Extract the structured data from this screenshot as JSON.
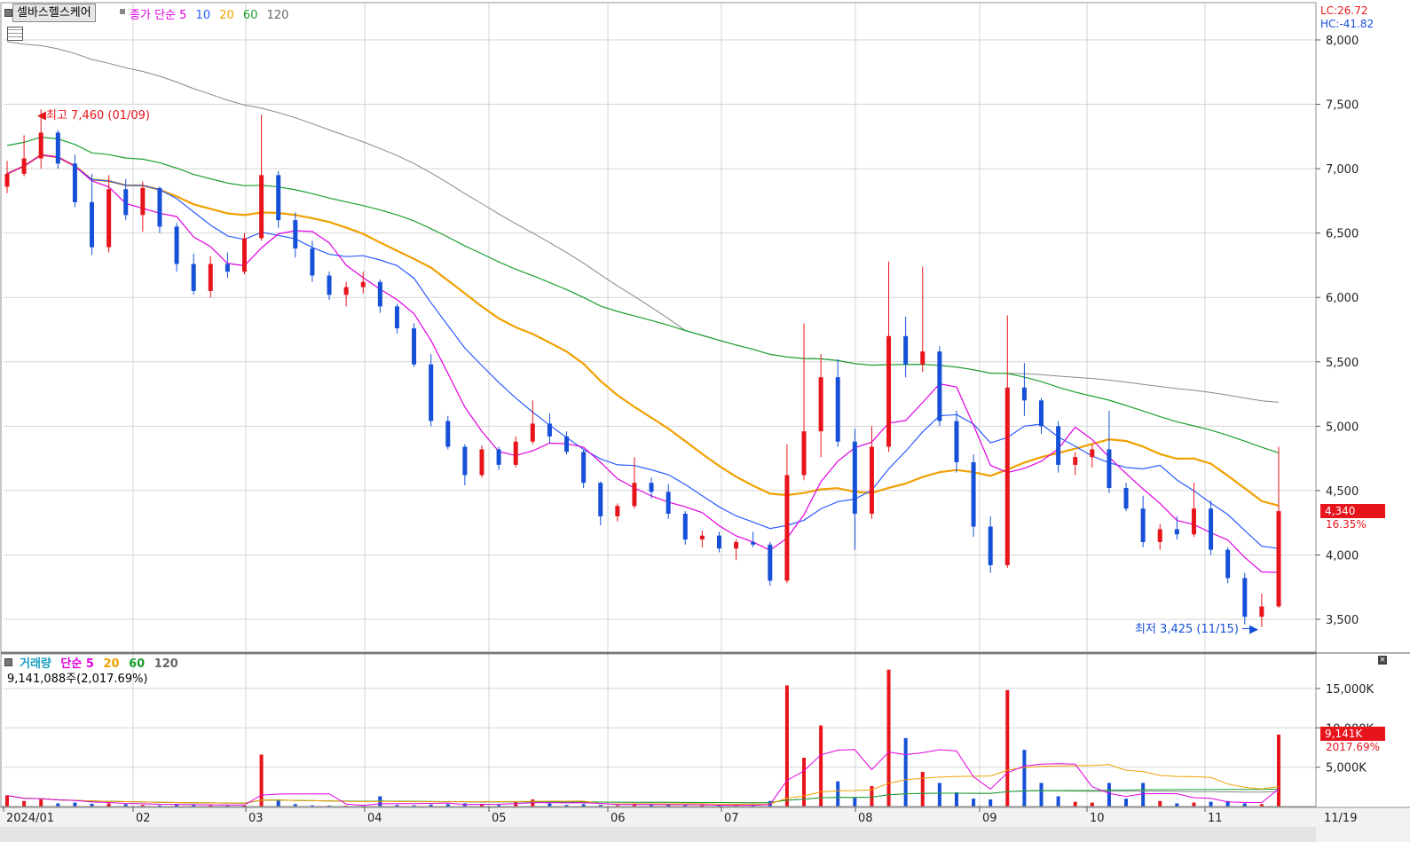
{
  "stock_name": "셀바스헬스케어",
  "price_panel": {
    "label": "종가",
    "ma_label": "단순",
    "ma_periods": [
      "5",
      "10",
      "20",
      "60",
      "120"
    ],
    "ma_colors": {
      "5": "#e000e0",
      "10": "#2a5cff",
      "20": "#f0a000",
      "60": "#1aa030",
      "120": "#888888"
    },
    "lc_text": "LC:26.72",
    "hc_text": "HC:-41.82",
    "high_note": "최고 7,460 (01/09)",
    "low_note": "최저 3,425 (11/15)",
    "current_price": "4,340",
    "current_change": "16.35%",
    "y_ticks": [
      "8,000",
      "7,500",
      "7,000",
      "6,500",
      "6,000",
      "5,500",
      "5,000",
      "4,500",
      "4,000",
      "3,500"
    ]
  },
  "volume_panel": {
    "label": "거래량",
    "ma_label": "단순",
    "ma_periods": [
      "5",
      "20",
      "60",
      "120"
    ],
    "value_text": "9,141,088주(2,017.69%)",
    "current_volume": "9,141K",
    "current_change": "2017.69%",
    "y_ticks": [
      "15,000K",
      "10,000K",
      "5,000K"
    ]
  },
  "x_axis": {
    "labels": [
      "2024/01",
      "02",
      "03",
      "04",
      "05",
      "06",
      "07",
      "08",
      "09",
      "10",
      "11"
    ],
    "end_label": "11/19"
  },
  "colors": {
    "up": "#e8141c",
    "down": "#1650d8",
    "grid": "#d4d4d4",
    "border": "#909090"
  },
  "chart_data": {
    "type": "candlestick",
    "period": "2024/01 – 11/19",
    "ylim": [
      3400,
      8100
    ],
    "volume_ylim": [
      0,
      18000
    ],
    "ma_periods": [
      5,
      10,
      20,
      60,
      120
    ],
    "volume_ma_periods": [
      5,
      20,
      60,
      120
    ],
    "high": {
      "value": 7460,
      "date": "01/09"
    },
    "low": {
      "value": 3425,
      "date": "11/15"
    },
    "last": {
      "close": 4340,
      "change_pct": 16.35,
      "volume_k": 9141,
      "volume_change_pct": 2017.69
    },
    "ohlc": [
      [
        6860,
        7060,
        6810,
        6960
      ],
      [
        6960,
        7260,
        6940,
        7080
      ],
      [
        7080,
        7460,
        7000,
        7280
      ],
      [
        7280,
        7300,
        7000,
        7040
      ],
      [
        7040,
        7110,
        6700,
        6740
      ],
      [
        6740,
        6960,
        6330,
        6390
      ],
      [
        6390,
        6950,
        6350,
        6840
      ],
      [
        6840,
        6920,
        6600,
        6640
      ],
      [
        6640,
        6900,
        6510,
        6850
      ],
      [
        6850,
        6860,
        6500,
        6550
      ],
      [
        6550,
        6580,
        6200,
        6260
      ],
      [
        6260,
        6340,
        6020,
        6050
      ],
      [
        6050,
        6320,
        6000,
        6260
      ],
      [
        6260,
        6350,
        6150,
        6200
      ],
      [
        6200,
        6500,
        6180,
        6460
      ],
      [
        6460,
        7420,
        6440,
        6950
      ],
      [
        6950,
        6980,
        6540,
        6600
      ],
      [
        6600,
        6660,
        6310,
        6380
      ],
      [
        6380,
        6440,
        6120,
        6170
      ],
      [
        6170,
        6200,
        5980,
        6020
      ],
      [
        6020,
        6120,
        5930,
        6080
      ],
      [
        6080,
        6200,
        6030,
        6120
      ],
      [
        6120,
        6140,
        5880,
        5930
      ],
      [
        5930,
        5950,
        5720,
        5760
      ],
      [
        5760,
        5800,
        5460,
        5480
      ],
      [
        5480,
        5560,
        5000,
        5040
      ],
      [
        5040,
        5080,
        4820,
        4840
      ],
      [
        4840,
        4860,
        4540,
        4620
      ],
      [
        4620,
        4850,
        4600,
        4820
      ],
      [
        4820,
        4840,
        4660,
        4700
      ],
      [
        4700,
        4920,
        4680,
        4880
      ],
      [
        4880,
        5200,
        4860,
        5020
      ],
      [
        5020,
        5100,
        4870,
        4920
      ],
      [
        4920,
        4960,
        4780,
        4800
      ],
      [
        4800,
        4820,
        4520,
        4560
      ],
      [
        4560,
        4570,
        4230,
        4300
      ],
      [
        4300,
        4400,
        4260,
        4380
      ],
      [
        4380,
        4760,
        4360,
        4560
      ],
      [
        4560,
        4600,
        4440,
        4490
      ],
      [
        4490,
        4550,
        4280,
        4320
      ],
      [
        4320,
        4340,
        4080,
        4120
      ],
      [
        4120,
        4190,
        4060,
        4150
      ],
      [
        4150,
        4180,
        4020,
        4050
      ],
      [
        4050,
        4120,
        3960,
        4100
      ],
      [
        4100,
        4180,
        4060,
        4080
      ],
      [
        4080,
        4100,
        3760,
        3800
      ],
      [
        3800,
        4860,
        3780,
        4620
      ],
      [
        4620,
        5800,
        4580,
        4960
      ],
      [
        4960,
        5560,
        4760,
        5380
      ],
      [
        5380,
        5520,
        4840,
        4880
      ],
      [
        4880,
        4980,
        4040,
        4320
      ],
      [
        4320,
        5000,
        4280,
        4840
      ],
      [
        4840,
        6280,
        4800,
        5700
      ],
      [
        5700,
        5850,
        5380,
        5480
      ],
      [
        5480,
        6240,
        5420,
        5580
      ],
      [
        5580,
        5620,
        5000,
        5040
      ],
      [
        5040,
        5120,
        4640,
        4720
      ],
      [
        4720,
        4780,
        4140,
        4220
      ],
      [
        4220,
        4300,
        3860,
        3920
      ],
      [
        3920,
        5860,
        3900,
        5300
      ],
      [
        5300,
        5490,
        5080,
        5200
      ],
      [
        5200,
        5220,
        4940,
        5000
      ],
      [
        5000,
        5040,
        4640,
        4700
      ],
      [
        4700,
        4800,
        4620,
        4760
      ],
      [
        4760,
        4860,
        4680,
        4820
      ],
      [
        4820,
        5120,
        4480,
        4520
      ],
      [
        4520,
        4560,
        4340,
        4360
      ],
      [
        4360,
        4460,
        4060,
        4100
      ],
      [
        4100,
        4240,
        4040,
        4200
      ],
      [
        4200,
        4300,
        4120,
        4160
      ],
      [
        4160,
        4560,
        4140,
        4360
      ],
      [
        4360,
        4420,
        4000,
        4040
      ],
      [
        4040,
        4060,
        3780,
        3820
      ],
      [
        3820,
        3860,
        3460,
        3520
      ],
      [
        3520,
        3700,
        3440,
        3600
      ],
      [
        3600,
        4840,
        3590,
        4340
      ]
    ],
    "volume_k": [
      1400,
      700,
      900,
      400,
      500,
      350,
      400,
      300,
      200,
      150,
      300,
      250,
      150,
      120,
      130,
      6600,
      900,
      300,
      150,
      120,
      100,
      90,
      1300,
      200,
      150,
      250,
      300,
      400,
      300,
      200,
      600,
      900,
      400,
      200,
      300,
      200,
      150,
      400,
      200,
      200,
      150,
      150,
      150,
      120,
      200,
      700,
      15400,
      6200,
      10300,
      3200,
      1100,
      2600,
      17400,
      8700,
      4400,
      3000,
      1800,
      1000,
      900,
      14800,
      7200,
      3000,
      1300,
      600,
      500,
      3000,
      1000,
      3000,
      700,
      400,
      500,
      600,
      700,
      400,
      300,
      9141
    ]
  }
}
